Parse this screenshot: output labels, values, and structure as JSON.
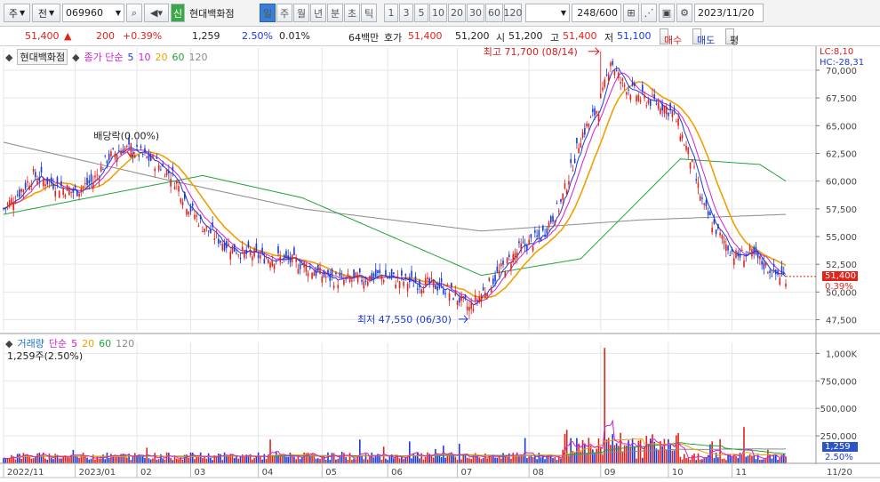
{
  "toolbar": {
    "market_type": "주",
    "compare": "전",
    "code": "069960",
    "badge": "신",
    "name": "현대백화점",
    "periods": [
      "일",
      "주",
      "월",
      "년",
      "분",
      "초",
      "틱"
    ],
    "selected_period": "일",
    "intervals": [
      "1",
      "3",
      "5",
      "10",
      "20",
      "30",
      "60",
      "120"
    ],
    "count": "248/600",
    "date": "2023/11/20"
  },
  "quote": {
    "price": "51,400",
    "arrow": "▲",
    "change": "200",
    "change_pct": "+0.39%",
    "volume": "1,259",
    "vol_ratio": "2.50%",
    "turnover": "0.01%",
    "amount": "64백만",
    "ask_label": "호가",
    "ask": "51,400",
    "bid": "51,200",
    "open_label": "시",
    "open": "51,200",
    "high_label": "고",
    "high": "51,400",
    "low_label": "저",
    "low": "51,100",
    "buy": "매수",
    "sell": "매도",
    "avg": "평"
  },
  "price_panel": {
    "stock_label": "현대백화점",
    "ma_title": "종가 단순",
    "ma_periods": [
      "5",
      "10",
      "20",
      "60",
      "120"
    ],
    "ma_colors": [
      "#1a3ad8",
      "#d21fd2",
      "#f0a000",
      "#22a33a",
      "#8a8a8a"
    ],
    "lc": "LC:8,10",
    "hc": "HC:-28,31",
    "last_price": "51,400",
    "last_pct": "0.39%",
    "high_annot": "최고 71,700 (08/14)",
    "low_annot": "최저 47,550 (06/30)",
    "div_annot": "배당락(0.00%)",
    "y_ticks": [
      "70,000",
      "67,500",
      "65,000",
      "62,500",
      "60,000",
      "57,500",
      "55,000",
      "52,500",
      "50,000",
      "47,500"
    ]
  },
  "volume_panel": {
    "label": "거래량",
    "ma_title": "단순",
    "ma_periods": [
      "5",
      "20",
      "60",
      "120"
    ],
    "sub": "1,259주(2.50%)",
    "last": "1,259",
    "last_pct": "2.50%",
    "y_ticks": [
      "1,000K",
      "750,000",
      "500,000",
      "250,000"
    ]
  },
  "x_axis": {
    "labels": [
      "2022/11",
      "2023/01",
      "02",
      "03",
      "04",
      "05",
      "06",
      "07",
      "08",
      "09",
      "10",
      "11",
      "11/20"
    ]
  },
  "chart_data": {
    "type": "candlestick",
    "ylim": [
      46500,
      72000
    ],
    "y_ticks": [
      47500,
      50000,
      52500,
      55000,
      57500,
      60000,
      62500,
      65000,
      67500,
      70000
    ],
    "months": [
      "2022/11",
      "2023/01",
      "02",
      "03",
      "04",
      "05",
      "06",
      "07",
      "08",
      "09",
      "10",
      "11"
    ],
    "close_profile": [
      [
        0,
        57500
      ],
      [
        8,
        59000
      ],
      [
        15,
        60500
      ],
      [
        25,
        59800
      ],
      [
        35,
        59000
      ],
      [
        45,
        60000
      ],
      [
        52,
        62000
      ],
      [
        60,
        63000
      ],
      [
        68,
        62500
      ],
      [
        78,
        61500
      ],
      [
        85,
        60500
      ],
      [
        92,
        58000
      ],
      [
        100,
        56000
      ],
      [
        110,
        54500
      ],
      [
        120,
        53500
      ],
      [
        130,
        53200
      ],
      [
        140,
        53000
      ],
      [
        150,
        52500
      ],
      [
        160,
        51500
      ],
      [
        170,
        51000
      ],
      [
        180,
        51200
      ],
      [
        190,
        51500
      ],
      [
        200,
        51000
      ],
      [
        210,
        50800
      ],
      [
        220,
        50500
      ],
      [
        228,
        49500
      ],
      [
        234,
        48500
      ],
      [
        240,
        49800
      ],
      [
        250,
        52000
      ],
      [
        260,
        54000
      ],
      [
        270,
        55000
      ],
      [
        280,
        58000
      ],
      [
        290,
        64000
      ],
      [
        300,
        67000
      ],
      [
        305,
        71000
      ],
      [
        310,
        69000
      ],
      [
        320,
        67500
      ],
      [
        330,
        67000
      ],
      [
        337,
        66000
      ],
      [
        345,
        62000
      ],
      [
        352,
        57500
      ],
      [
        360,
        55000
      ],
      [
        368,
        53200
      ],
      [
        375,
        53500
      ],
      [
        382,
        52500
      ],
      [
        388,
        51600
      ],
      [
        393,
        51400
      ]
    ],
    "ma_120": [
      [
        0,
        63500
      ],
      [
        80,
        60200
      ],
      [
        150,
        57500
      ],
      [
        240,
        55500
      ],
      [
        320,
        56500
      ],
      [
        393,
        57000
      ]
    ],
    "ma_60": [
      [
        0,
        57000
      ],
      [
        100,
        60500
      ],
      [
        150,
        58500
      ],
      [
        240,
        51500
      ],
      [
        290,
        53000
      ],
      [
        340,
        62000
      ],
      [
        380,
        61500
      ],
      [
        393,
        60000
      ]
    ],
    "volume": {
      "ylim": [
        0,
        1100000
      ],
      "y_ticks": [
        250000,
        500000,
        750000,
        1000000
      ],
      "max": 1050000,
      "max_index": 302
    }
  }
}
